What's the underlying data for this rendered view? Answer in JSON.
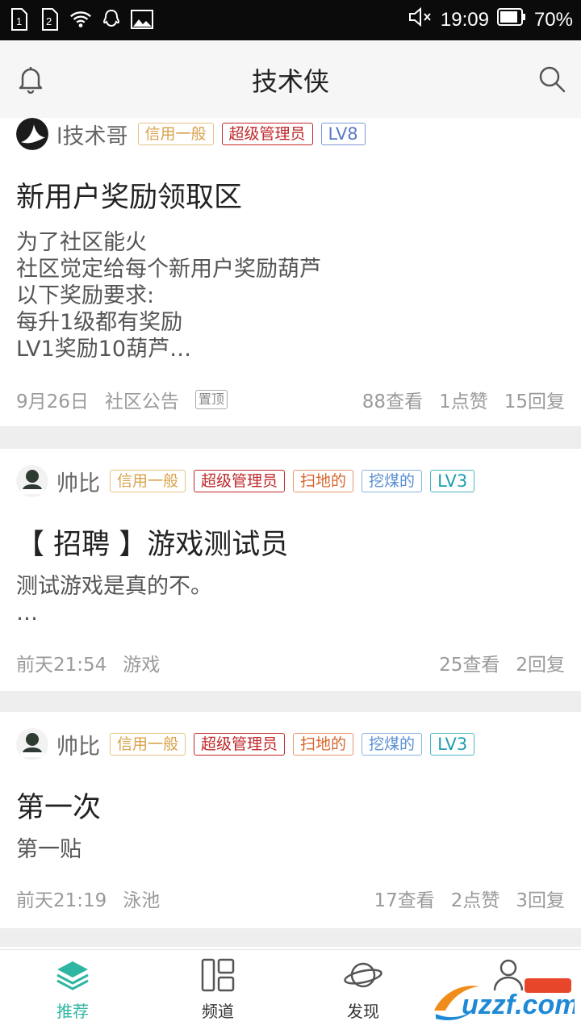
{
  "status_bar": {
    "time": "19:09",
    "battery": "70%",
    "sim1": "1",
    "sim2": "2"
  },
  "app": {
    "title": "技术侠"
  },
  "posts": [
    {
      "author": "l技术哥",
      "badges": [
        "信用一般",
        "超级管理员",
        "LV8"
      ],
      "title": "新用户奖励领取区",
      "body_lines": [
        "为了社区能火",
        "社区觉定给每个新用户奖励葫芦",
        "以下奖励要求:",
        "每升1级都有奖励",
        "LV1奖励10葫芦…"
      ],
      "date": "9月26日",
      "category": "社区公告",
      "pin": "置顶",
      "views": "88查看",
      "likes": "1点赞",
      "replies": "15回复"
    },
    {
      "author": "帅比",
      "badges": [
        "信用一般",
        "超级管理员",
        "扫地的",
        "挖煤的",
        "LV3"
      ],
      "title": "【 招聘 】游戏测试员",
      "body_lines": [
        "测试游戏是真的不。",
        "…"
      ],
      "date": "前天21:54",
      "category": "游戏",
      "views": "25查看",
      "replies": "2回复"
    },
    {
      "author": "帅比",
      "badges": [
        "信用一般",
        "超级管理员",
        "扫地的",
        "挖煤的",
        "LV3"
      ],
      "title": "第一次",
      "body_lines": [
        "第一贴"
      ],
      "date": "前天21:19",
      "category": "泳池",
      "views": "17查看",
      "likes": "2点赞",
      "replies": "3回复"
    }
  ],
  "tabs": [
    {
      "label": "推荐",
      "icon": "layers-icon",
      "active": true
    },
    {
      "label": "频道",
      "icon": "grid-icon"
    },
    {
      "label": "发现",
      "icon": "planet-icon"
    },
    {
      "label": "",
      "icon": "person-icon"
    }
  ],
  "watermark": "uzzf.com",
  "accent_color": "#2fb6a2"
}
